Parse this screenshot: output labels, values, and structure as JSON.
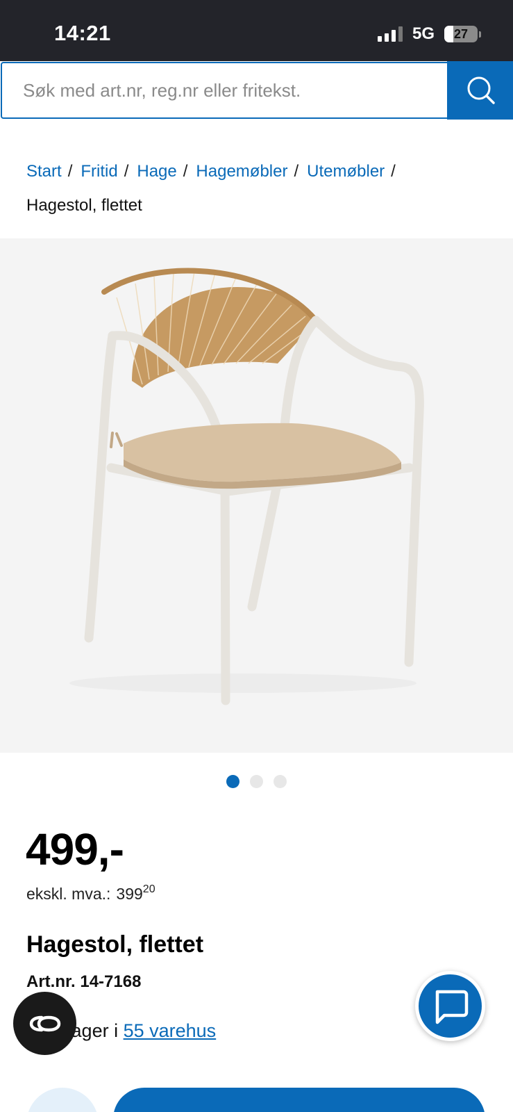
{
  "status_bar": {
    "time": "14:21",
    "network": "5G",
    "battery": "27",
    "battery_level": 0.27
  },
  "search": {
    "placeholder": "Søk med art.nr, reg.nr eller fritekst.",
    "button_icon": "search-icon",
    "accent_color": "#0a6ab8"
  },
  "breadcrumb": {
    "items": [
      "Start",
      "Fritid",
      "Hage",
      "Hagemøbler",
      "Utemøbler"
    ],
    "separator": "/",
    "current": "Hagestol, flettet"
  },
  "gallery": {
    "image_subject": "chair-image",
    "slide_count": 3,
    "active_slide": 1
  },
  "price": {
    "main": "499,-",
    "ex_vat_label": "ekskl. mva.:",
    "ex_vat_value": "399",
    "ex_vat_cents": "20"
  },
  "product": {
    "title": "Hagestol, flettet",
    "art_nr": "Art.nr. 14-7168",
    "stock_prefix": "s på lager i",
    "stock_link": "55 varehus"
  },
  "floating": {
    "co_icon": "co-icon",
    "chat_icon": "chat-icon"
  }
}
